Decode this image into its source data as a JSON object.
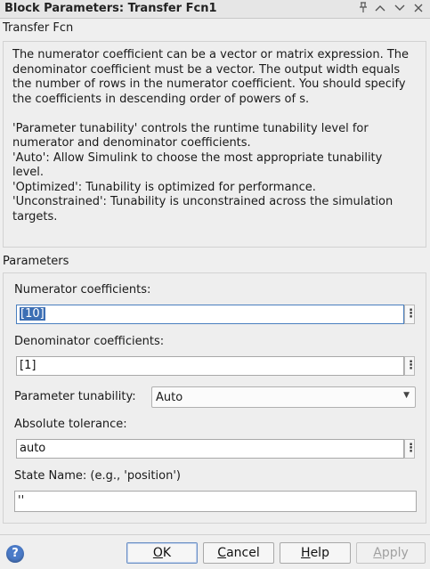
{
  "window": {
    "title": "Block Parameters: Transfer Fcn1",
    "controls": [
      "pin-icon",
      "maximize-icon",
      "minimize-icon",
      "close-icon"
    ]
  },
  "block": {
    "name": "Transfer Fcn",
    "description": [
      "The numerator coefficient can be a vector or matrix expression. The denominator coefficient must be a vector. The output width equals the number of rows in the numerator coefficient. You should specify the coefficients in descending order of powers of s.",
      "",
      "'Parameter tunability' controls the runtime tunability level for numerator and denominator coefficients.",
      "'Auto': Allow Simulink to choose the most appropriate tunability level.",
      "'Optimized': Tunability is optimized for performance.",
      "'Unconstrained': Tunability is unconstrained across the simulation targets."
    ]
  },
  "parameters": {
    "section_title": "Parameters",
    "numerator": {
      "label": "Numerator coefficients:",
      "value": "[10]"
    },
    "denominator": {
      "label": "Denominator coefficients:",
      "value": "[1]"
    },
    "tunability": {
      "label": "Parameter tunability:",
      "value": "Auto"
    },
    "abs_tol": {
      "label": "Absolute tolerance:",
      "value": "auto"
    },
    "state_name": {
      "label": "State Name: (e.g., 'position')",
      "value": "''"
    }
  },
  "buttons": {
    "ok": {
      "pre": "",
      "key": "O",
      "post": "K"
    },
    "cancel": {
      "pre": "",
      "key": "C",
      "post": "ancel"
    },
    "help": {
      "pre": "",
      "key": "H",
      "post": "elp"
    },
    "apply": {
      "pre": "",
      "key": "A",
      "post": "pply"
    }
  },
  "colors": {
    "selection": "#3d6fb4",
    "help_icon": "#4b7bc8"
  }
}
